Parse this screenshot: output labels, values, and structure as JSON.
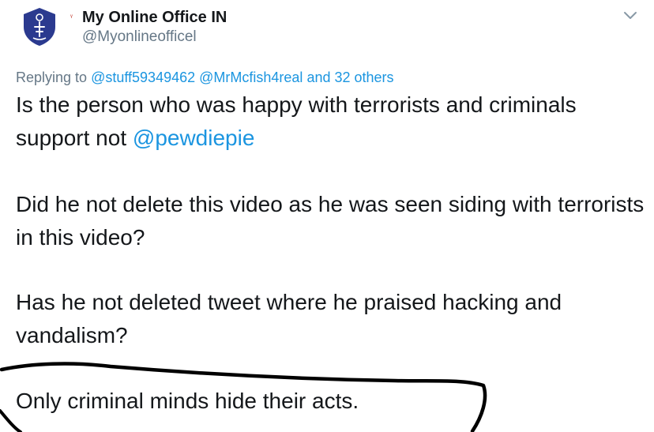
{
  "tweet": {
    "author": {
      "display_name": "My Online Office IN",
      "handle": "@Myonlineofficel",
      "avatar_icon": "shield-logo-icon",
      "avatar_color": "#2b3a8f"
    },
    "menu_icon": "chevron-down-icon",
    "replying": {
      "prefix": "Replying to",
      "mentions": [
        "@stuff59349462",
        "@MrMcfish4real"
      ],
      "suffix": "and 32 others"
    },
    "paragraphs": {
      "p1_text": "Is the person who was happy with terrorists and criminals support not",
      "p1_mention": "@pewdiepie",
      "p2": "Did he not delete this video as he was seen siding with terrorists in this video?",
      "p3": "Has he not deleted tweet where he praised hacking and vandalism?",
      "p4": "Only criminal minds hide their acts."
    },
    "colors": {
      "mention": "#1b95e0",
      "secondary": "#657786",
      "text": "#14171a",
      "annotation": "#000000"
    }
  }
}
